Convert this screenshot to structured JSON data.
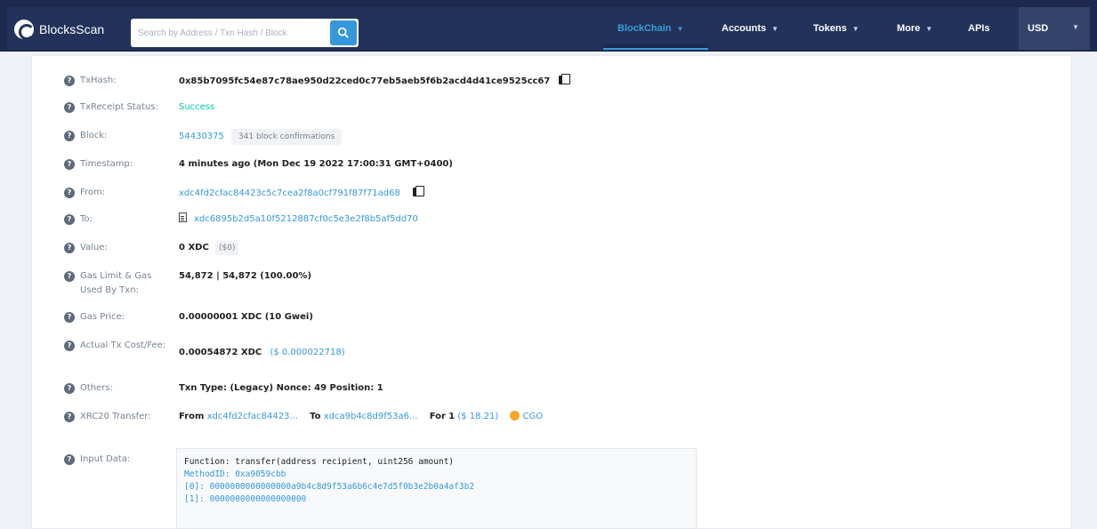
{
  "header": {
    "brand": "BlocksScan",
    "search_placeholder": "Search by Address / Txn Hash / Block",
    "nav": [
      {
        "label": "BlockChain",
        "active": true
      },
      {
        "label": "Accounts",
        "active": false
      },
      {
        "label": "Tokens",
        "active": false
      },
      {
        "label": "More",
        "active": false
      },
      {
        "label": "APIs",
        "active": false
      }
    ],
    "currency": "USD"
  },
  "details": {
    "txhash": {
      "label": "TxHash:",
      "value": "0x85b7095fc54e87c78ae950d22ced0c77eb5aeb5f6b2acd4d41ce9525cc67"
    },
    "status": {
      "label": "TxReceipt Status:",
      "value": "Success"
    },
    "block": {
      "label": "Block:",
      "value": "54430375",
      "confirmations": "341 block confirmations"
    },
    "timestamp": {
      "label": "Timestamp:",
      "value": "4 minutes ago (Mon Dec 19 2022 17:00:31 GMT+0400)"
    },
    "from": {
      "label": "From:",
      "value": "xdc4fd2cfac84423c5c7cea2f8a0cf791f87f71ad68"
    },
    "to": {
      "label": "To:",
      "value": "xdc6895b2d5a10f5212887cf0c5e3e2f8b5af5dd70"
    },
    "value": {
      "label": "Value:",
      "value": "0 XDC",
      "fiat": "($0)"
    },
    "gas_limit": {
      "label": "Gas Limit & Gas Used By Txn:",
      "value": "54,872 | 54,872 (100.00%)"
    },
    "gas_price": {
      "label": "Gas Price:",
      "value": "0.00000001 XDC (10 Gwei)"
    },
    "fee": {
      "label": "Actual Tx Cost/Fee:",
      "value": "0.00054872 XDC",
      "fiat": "($ 0.000022718)"
    },
    "others": {
      "label": "Others:",
      "value": "Txn Type: (Legacy) Nonce: 49 Position: 1"
    },
    "xrc20": {
      "label": "XRC20 Transfer:",
      "from_label": "From",
      "from_value": "xdc4fd2cfac84423...",
      "to_label": "To",
      "to_value": "xdca9b4c8d9f53a6...",
      "for_label": "For",
      "amount": "1",
      "fiat": "($ 18.21)",
      "token": "CGO"
    },
    "input": {
      "label": "Input Data:",
      "lines": [
        "Function: transfer(address recipient, uint256 amount)",
        "MethodID: 0xa9059cbb",
        "[0]: 0000000000000000a9b4c8d9f53a6b6c4e7d5f0b3e2b0a4af3b2",
        "[1]: 0000000000000000000"
      ]
    }
  }
}
